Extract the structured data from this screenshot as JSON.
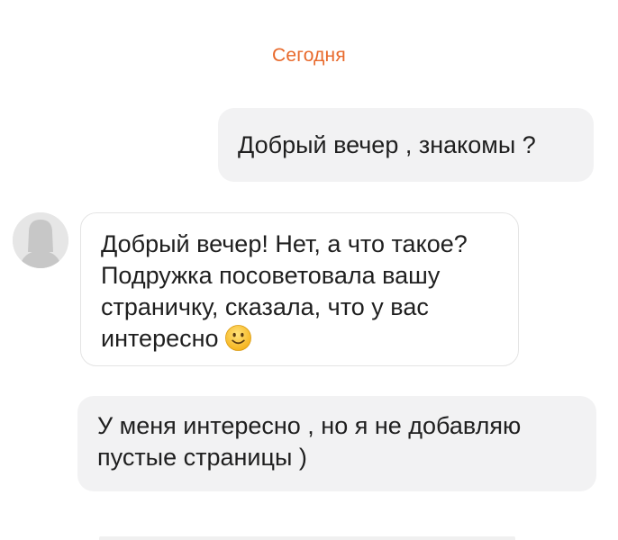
{
  "chat": {
    "date_separator": "Сегодня",
    "messages": [
      {
        "direction": "outgoing",
        "text": "Добрый вечер , знакомы ?"
      },
      {
        "direction": "incoming",
        "text": "Добрый вечер! Нет, а что такое? Подружка посоветовала вашу страничку, сказала, что у вас интересно",
        "emoji": "slightly-smiling-face-emoji"
      },
      {
        "direction": "outgoing",
        "text": "У меня интересно , но я не добавляю пустые страницы )"
      }
    ]
  },
  "colors": {
    "accent_date": "#e8692b",
    "outgoing_bubble": "#f2f2f3",
    "incoming_bubble": "#ffffff",
    "incoming_border": "#e4e4e4",
    "avatar_bg": "#e6e6e6",
    "avatar_silhouette": "#c7c7c7"
  },
  "icons": {
    "avatar": "user-silhouette-icon"
  }
}
